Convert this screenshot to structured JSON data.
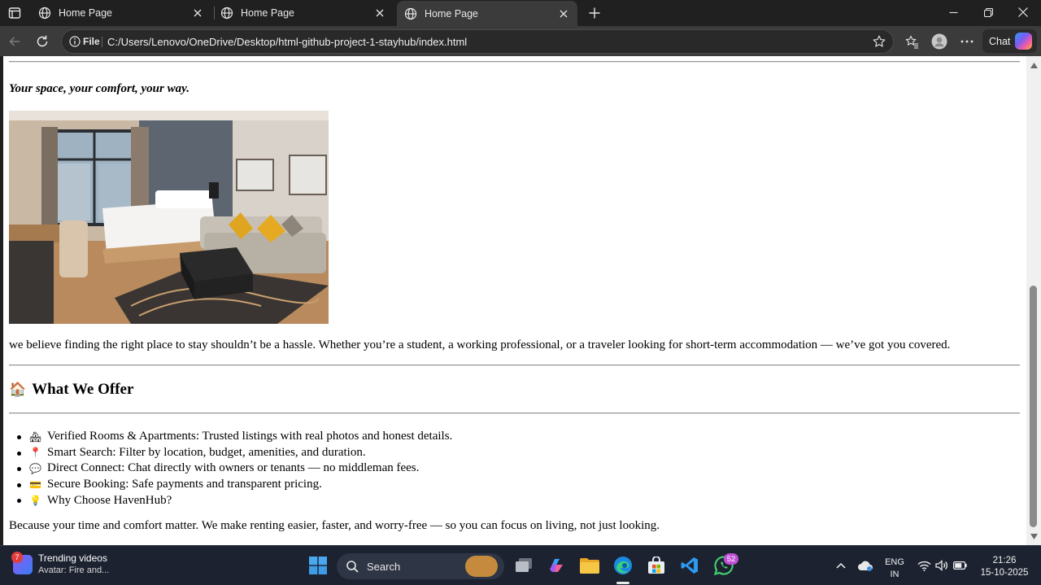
{
  "browser": {
    "tabs": [
      {
        "title": "Home Page",
        "active": false
      },
      {
        "title": "Home Page",
        "active": false
      },
      {
        "title": "Home Page",
        "active": true
      }
    ],
    "address": {
      "scheme_label": "File",
      "url": "C:/Users/Lenovo/OneDrive/Desktop/html-github-project-1-stayhub/index.html"
    },
    "chat_label": "Chat"
  },
  "page": {
    "tagline": "Your space, your comfort, your way.",
    "intro": "we believe finding the right place to stay shouldn’t be a hassle. Whether you’re a student, a working professional, or a traveler looking for short-term accommodation — we’ve got you covered.",
    "offer_heading": "What We Offer",
    "offer_items": [
      {
        "emoji": "🏘",
        "text": "Verified Rooms & Apartments: Trusted listings with real photos and honest details."
      },
      {
        "emoji": "📍",
        "text": "Smart Search: Filter by location, budget, amenities, and duration."
      },
      {
        "emoji": "💬",
        "text": "Direct Connect: Chat directly with owners or tenants — no middleman fees."
      },
      {
        "emoji": "💳",
        "text": "Secure Booking: Safe payments and transparent pricing."
      },
      {
        "emoji": "💡",
        "text": "Why Choose HavenHub?"
      }
    ],
    "closing": "Because your time and comfort matter. We make renting easier, faster, and worry-free — so you can focus on living, not just looking."
  },
  "taskbar": {
    "widget_badge": "7",
    "widget_title": "Trending videos",
    "widget_subtitle": "Avatar: Fire and...",
    "search_label": "Search",
    "whatsapp_badge": "52",
    "language_line1": "ENG",
    "language_line2": "IN",
    "time": "21:26",
    "date": "15-10-2025"
  }
}
